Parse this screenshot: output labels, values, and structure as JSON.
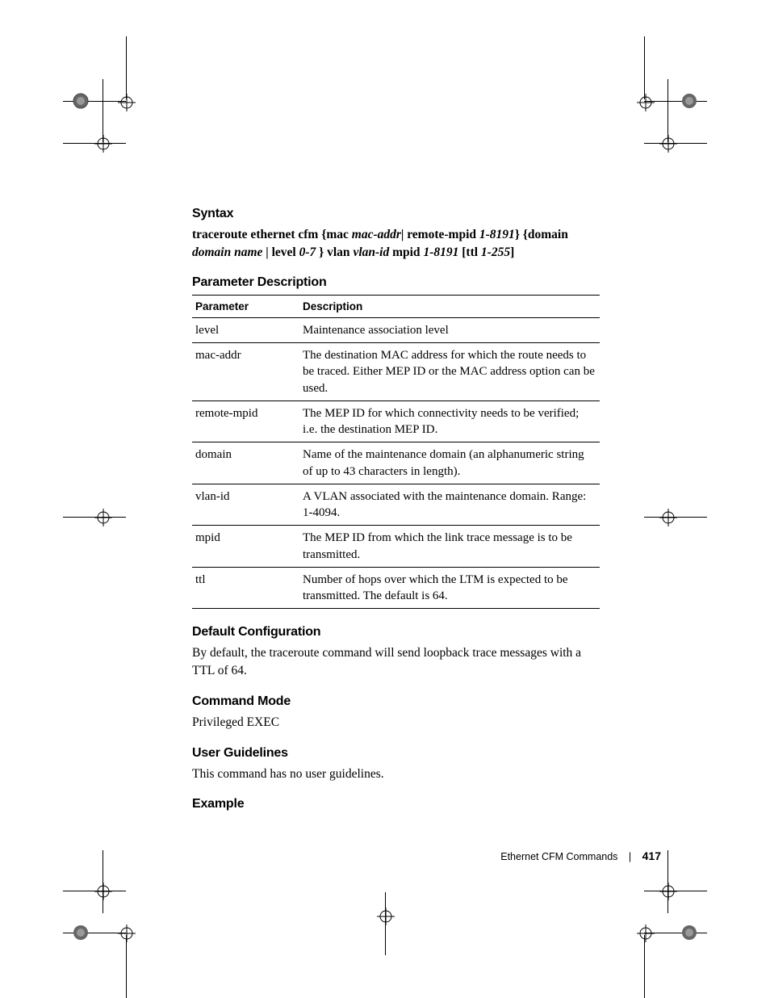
{
  "headings": {
    "syntax": "Syntax",
    "param_desc": "Parameter Description",
    "default_cfg": "Default Configuration",
    "cmd_mode": "Command Mode",
    "user_guide": "User Guidelines",
    "example": "Example"
  },
  "syntax": {
    "t1": "traceroute ethernet cfm {",
    "t2": "mac ",
    "t3": "mac-addr",
    "t4": "| ",
    "t5": " remote-mpid ",
    "t6": "1-8191",
    "t7": "} {domain",
    "t8": "domain name ",
    "t9": "| ",
    "t10": "level ",
    "t11": "0-7",
    "t12": " } vlan ",
    "t13": "vlan-id",
    "t14": " mpid ",
    "t15": "1-8191",
    "t16": " [",
    "t17": "ttl ",
    "t18": "1-255",
    "t19": "]"
  },
  "table": {
    "col1": "Parameter",
    "col2": "Description",
    "rows": [
      {
        "p": "level",
        "d": "Maintenance association level"
      },
      {
        "p": "mac-addr",
        "d": "The destination MAC address for which the route needs to be traced. Either MEP ID or the MAC address option can be used."
      },
      {
        "p": "remote-mpid",
        "d": "The MEP ID for which connectivity needs to be verified; i.e. the destination MEP ID."
      },
      {
        "p": "domain",
        "d": "Name of the maintenance domain (an alphanumeric string of up to 43 characters in length)."
      },
      {
        "p": "vlan-id",
        "d": "A VLAN associated with the maintenance domain. Range: 1-4094."
      },
      {
        "p": "mpid",
        "d": "The MEP ID from which the link trace message is to be transmitted."
      },
      {
        "p": "ttl",
        "d": "Number of hops over which the LTM is expected to be transmitted. The default is 64."
      }
    ]
  },
  "default_cfg_text": "By default, the traceroute command will send loopback trace messages with a TTL of 64.",
  "cmd_mode_text": "Privileged EXEC",
  "user_guide_text": "This command has no user guidelines.",
  "footer": {
    "section": "Ethernet CFM Commands",
    "page": "417"
  }
}
